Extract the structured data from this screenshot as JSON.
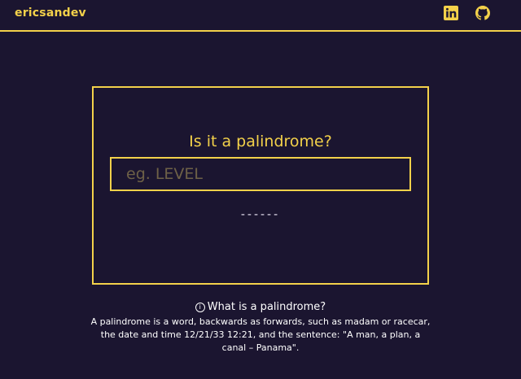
{
  "header": {
    "brand": "ericsandev",
    "icons": [
      "linkedin-icon",
      "github-icon"
    ]
  },
  "card": {
    "title": "Is it a palindrome?",
    "input": {
      "value": "",
      "placeholder": "eg. LEVEL"
    },
    "result": "------"
  },
  "info": {
    "icon": "info-icon",
    "title": "What is a palindrome?",
    "text": "A palindrome is a word, backwards as forwards, such as madam or racecar, the date and time 12/21/33 12:21, and the sentence: \"A man, a plan, a canal – Panama\"."
  },
  "colors": {
    "background": "#1b1530",
    "accent": "#f3d14a",
    "text": "#ffffff"
  }
}
